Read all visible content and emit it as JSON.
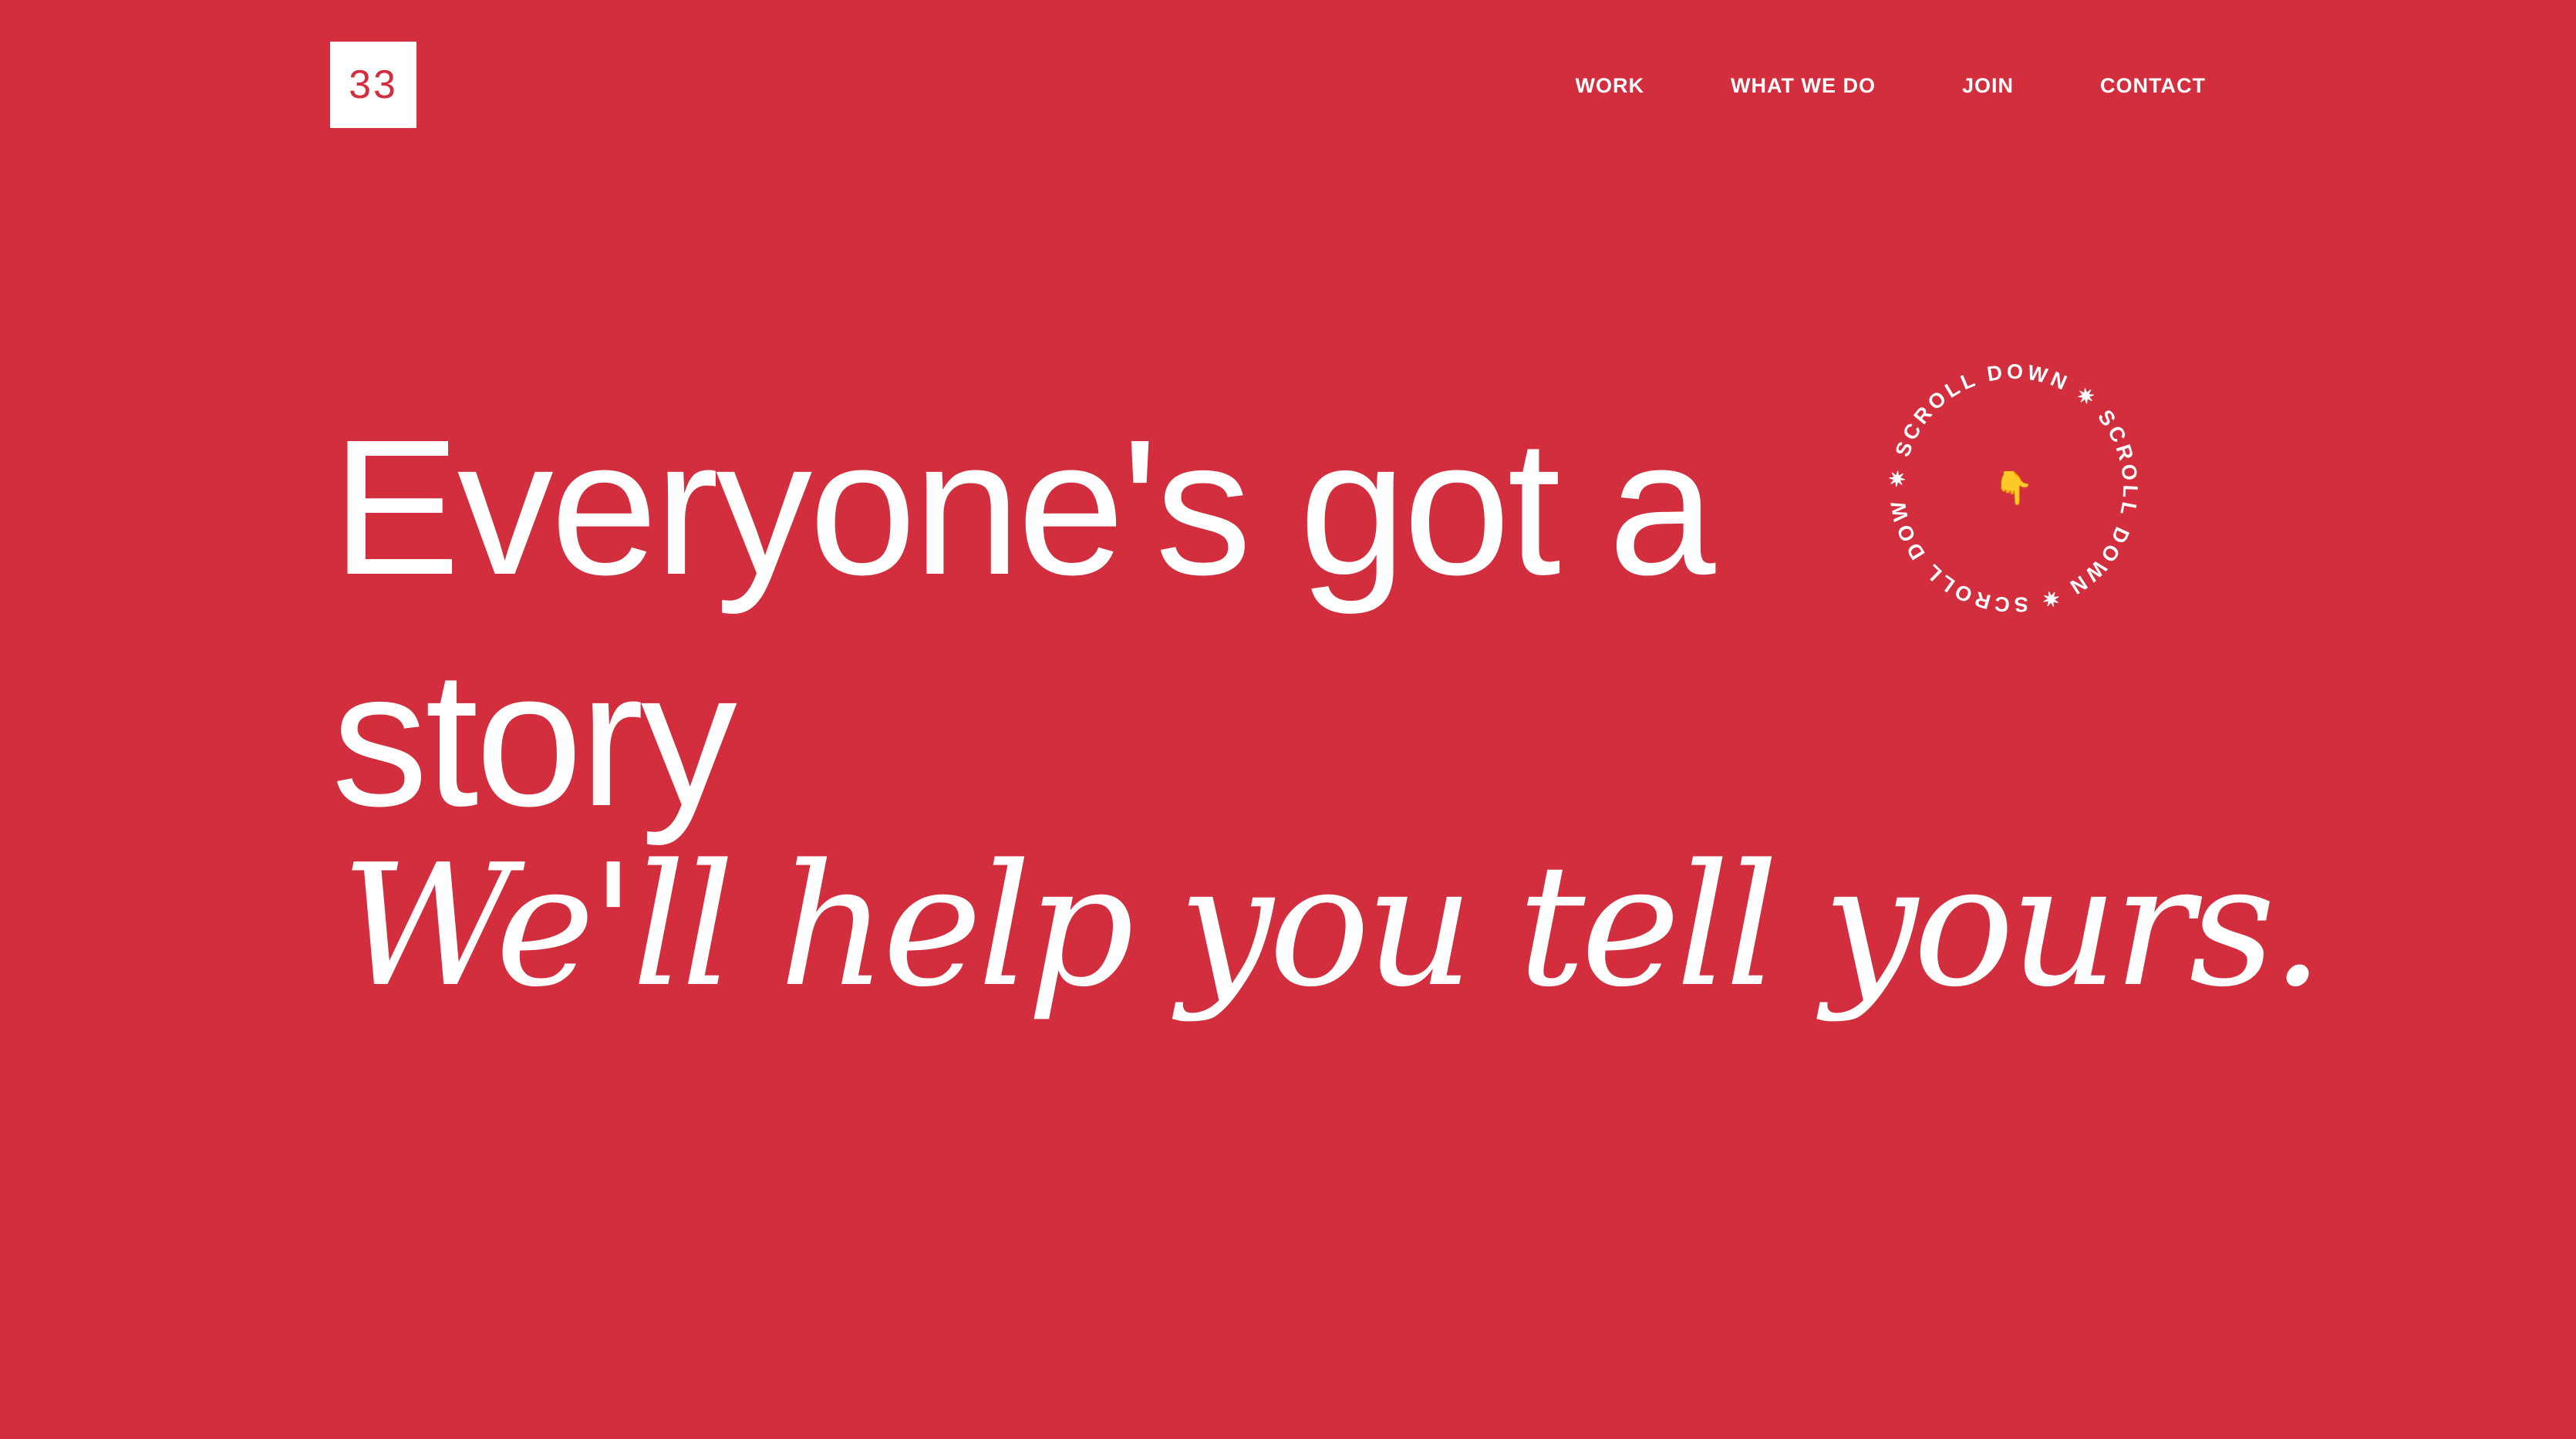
{
  "logo": {
    "text": "33"
  },
  "nav": {
    "items": [
      {
        "label": "WORK"
      },
      {
        "label": "WHAT WE DO"
      },
      {
        "label": "JOIN"
      },
      {
        "label": "CONTACT"
      }
    ]
  },
  "hero": {
    "headline": "Everyone's got a story",
    "subline": "We'll help you tell yours."
  },
  "scroll_badge": {
    "ring_text": "✷ SCROLL DOWN ✷ SCROLL DOWN ✷ SCROLL DOWN",
    "icon": "pointing-down-hand-icon",
    "icon_glyph": "👇"
  },
  "colors": {
    "background": "#d22e3d",
    "foreground": "#ffffff",
    "icon": "#f6c231"
  }
}
